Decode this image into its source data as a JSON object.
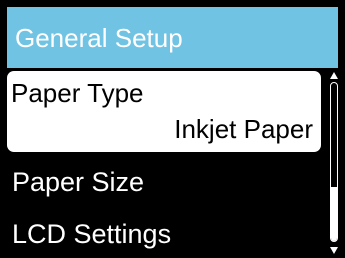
{
  "title_bar": {
    "title": "General Setup"
  },
  "menu": {
    "items": [
      {
        "label": "Paper Type",
        "value": "Inkjet Paper",
        "selected": true
      },
      {
        "label": "Paper Size"
      },
      {
        "label": "LCD Settings"
      }
    ]
  },
  "scrollbar": {
    "up_icon": "arrow-up-icon",
    "down_icon": "arrow-down-icon",
    "thumb_fraction": 0.34
  },
  "colors": {
    "title_bar_bg": "#71c3e3",
    "screen_bg": "#000000",
    "selected_bg": "#ffffff",
    "text_primary": "#ffffff",
    "text_selected": "#000000"
  }
}
